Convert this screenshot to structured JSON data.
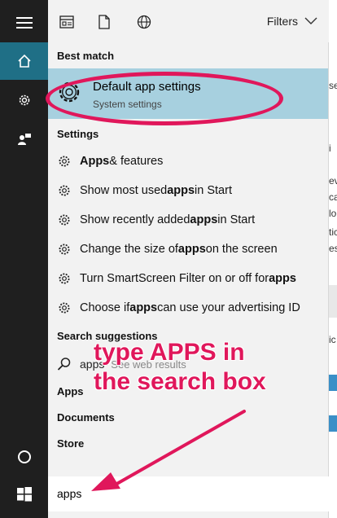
{
  "tabs": {
    "filters_label": "Filters"
  },
  "best_match": {
    "heading": "Best match",
    "title": "Default app settings",
    "subtitle": "System settings"
  },
  "settings": {
    "heading": "Settings",
    "items": [
      {
        "pre": "",
        "bold": "Apps",
        "post": " & features"
      },
      {
        "pre": "Show most used ",
        "bold": "apps",
        "post": " in Start"
      },
      {
        "pre": "Show recently added ",
        "bold": "apps",
        "post": " in Start"
      },
      {
        "pre": "Change the size of ",
        "bold": "apps",
        "post": " on the screen"
      },
      {
        "pre": "Turn SmartScreen Filter on or off for ",
        "bold": "apps",
        "post": ""
      },
      {
        "pre": "Choose if ",
        "bold": "apps",
        "post": " can use your advertising ID"
      }
    ]
  },
  "suggestions": {
    "heading": "Search suggestions",
    "query": "apps",
    "hint": " - See web results"
  },
  "categories": {
    "apps": "Apps",
    "documents": "Documents",
    "store": "Store"
  },
  "search": {
    "value": "apps"
  },
  "annotation": {
    "line1": "type APPS in",
    "line2": "the search box"
  },
  "background_text": [
    "se",
    "i",
    "eve",
    "ca",
    "lo",
    "tic",
    "es",
    "ic"
  ],
  "colors": {
    "accent": "#1f6f86",
    "highlight": "#a7d0df",
    "annotation": "#e0175b",
    "rail": "#1f1f1f"
  }
}
